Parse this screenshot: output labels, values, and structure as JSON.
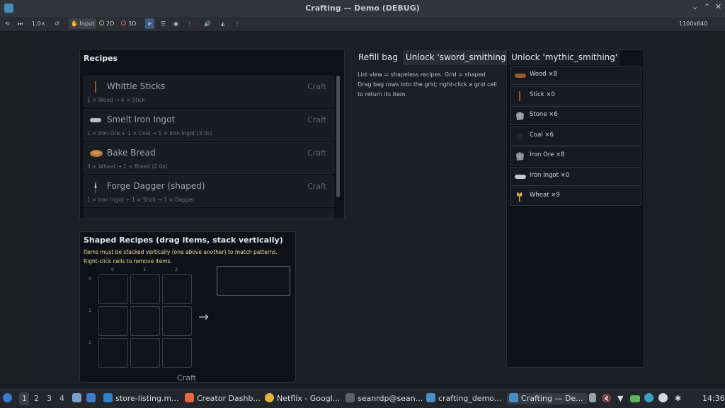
{
  "window": {
    "title": "Crafting — Demo (DEBUG)"
  },
  "toolbar": {
    "speed": "1.0×",
    "input": "Input",
    "mode_2d": "2D",
    "mode_3d": "3D",
    "resolution": "1100x640"
  },
  "recipes": {
    "title": "Recipes",
    "items": [
      {
        "name": "Whittle Sticks",
        "craft": "Craft",
        "desc": "1 × Wood → 4 × Stick",
        "icon": "stick-icon"
      },
      {
        "name": "Smelt Iron Ingot",
        "craft": "Craft",
        "desc": "1 × Iron Ore + 1 × Coal → 1 × Iron Ingot (3.0s)",
        "icon": "ingot-icon"
      },
      {
        "name": "Bake Bread",
        "craft": "Craft",
        "desc": "3 × Wheat → 1 × Bread (2.0s)",
        "icon": "bread-icon"
      },
      {
        "name": "Forge Dagger (shaped)",
        "craft": "Craft",
        "desc": "1 × Iron Ingot + 1 × Stick → 1 × Dagger",
        "icon": "dagger-icon"
      }
    ]
  },
  "actions": {
    "refill": "Refill bag",
    "unlock_sword": "Unlock 'sword_smithing'",
    "unlock_mythic": "Unlock 'mythic_smithing'"
  },
  "help_text": "List view = shapeless recipes. Grid = shaped. Drag bag rows into the grid; right-click a grid cell to return its item.",
  "inventory": [
    {
      "label": "Wood ×8",
      "icon": "wood-icon"
    },
    {
      "label": "Stick ×0",
      "icon": "stick-icon"
    },
    {
      "label": "Stone ×6",
      "icon": "stone-icon"
    },
    {
      "label": "Coal ×6",
      "icon": "coal-icon"
    },
    {
      "label": "Iron Ore ×8",
      "icon": "iron-ore-icon"
    },
    {
      "label": "Iron Ingot ×0",
      "icon": "ingot-icon"
    },
    {
      "label": "Wheat ×9",
      "icon": "wheat-icon"
    }
  ],
  "shaped": {
    "title": "Shaped Recipes (drag items, stack vertically)",
    "note": "Items must be stacked vertically (one above another) to match patterns. Right-click cells to remove items.",
    "col_labels": [
      "0",
      "1",
      "2"
    ],
    "row_labels": [
      "0",
      "1",
      "2"
    ],
    "arrow": "→",
    "craft": "Craft"
  },
  "taskbar": {
    "workspaces": [
      "1",
      "2",
      "3",
      "4"
    ],
    "apps": [
      {
        "label": "store-listing.m...",
        "color": "#2f80d1"
      },
      {
        "label": "Creator Dashb...",
        "color": "#e8683a"
      },
      {
        "label": "Netflix - Googl...",
        "color": "#e2b33b"
      },
      {
        "label": "seanrdp@sean...",
        "color": "#5a5f68"
      },
      {
        "label": "crafting_demo...",
        "color": "#4a8ec8"
      },
      {
        "label": "Crafting — De...",
        "color": "#4a8ec8"
      }
    ],
    "clock": "14:36"
  },
  "colors": {
    "accent": "#3b5a86",
    "panel": "#0f1117",
    "viewport": "#1b1d27"
  }
}
